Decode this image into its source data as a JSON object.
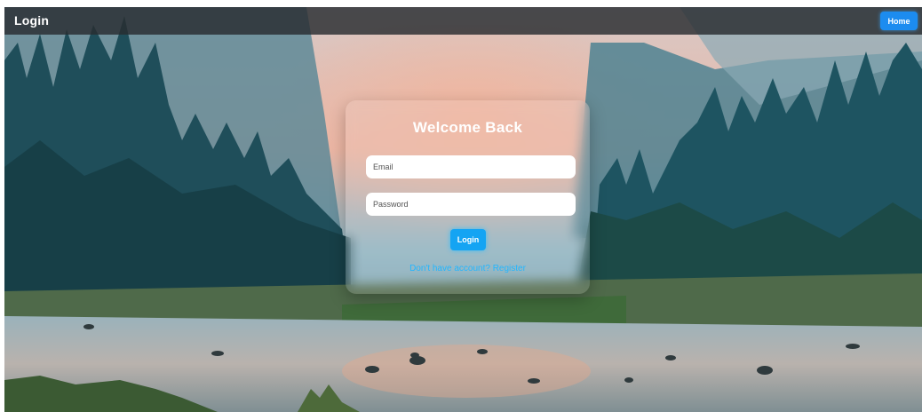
{
  "header": {
    "title": "Login",
    "home_label": "Home"
  },
  "login_card": {
    "title": "Welcome Back",
    "email_placeholder": "Email",
    "password_placeholder": "Password",
    "login_label": "Login",
    "register_link": "Don't have account? Register"
  },
  "colors": {
    "accent": "#1c8cf0",
    "link": "#22b6ff",
    "navbar": "#2c3034"
  }
}
